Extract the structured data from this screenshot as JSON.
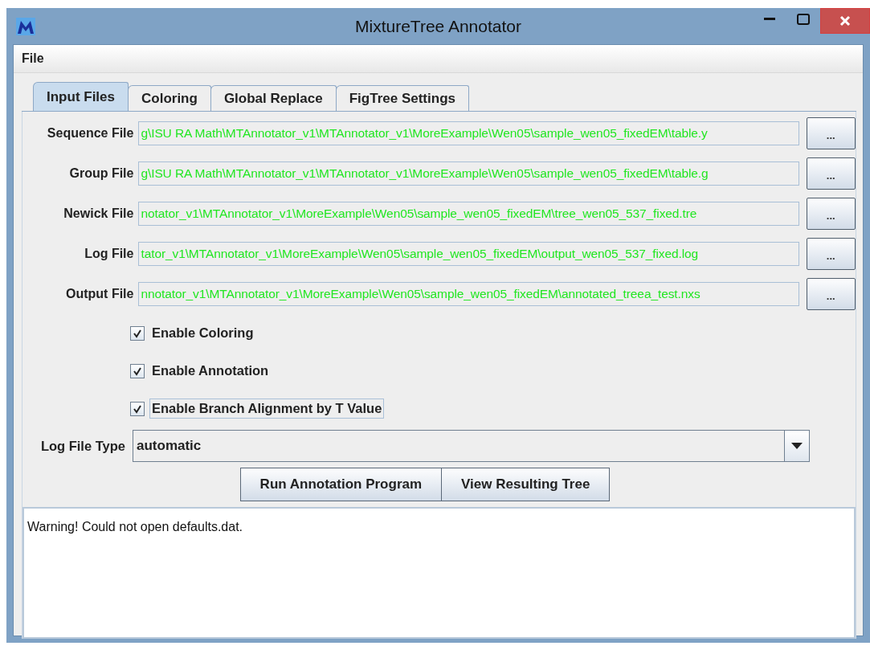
{
  "window": {
    "title": "MixtureTree Annotator"
  },
  "menu": [
    "File"
  ],
  "tabs": [
    {
      "label": "Input Files",
      "selected": true
    },
    {
      "label": "Coloring",
      "selected": false
    },
    {
      "label": "Global Replace",
      "selected": false
    },
    {
      "label": "FigTree Settings",
      "selected": false
    }
  ],
  "file_fields": [
    {
      "label": "Sequence File",
      "value": "g\\ISU RA Math\\MTAnnotator_v1\\MTAnnotator_v1\\MoreExample\\Wen05\\sample_wen05_fixedEM\\table.y",
      "button": "..."
    },
    {
      "label": "Group File",
      "value": "g\\ISU RA Math\\MTAnnotator_v1\\MTAnnotator_v1\\MoreExample\\Wen05\\sample_wen05_fixedEM\\table.g",
      "button": "..."
    },
    {
      "label": "Newick File",
      "value": "notator_v1\\MTAnnotator_v1\\MoreExample\\Wen05\\sample_wen05_fixedEM\\tree_wen05_537_fixed.tre",
      "button": "..."
    },
    {
      "label": "Log File",
      "value": "tator_v1\\MTAnnotator_v1\\MoreExample\\Wen05\\sample_wen05_fixedEM\\output_wen05_537_fixed.log",
      "button": "..."
    },
    {
      "label": "Output File",
      "value": "nnotator_v1\\MTAnnotator_v1\\MoreExample\\Wen05\\sample_wen05_fixedEM\\annotated_treea_test.nxs",
      "button": "..."
    }
  ],
  "checkboxes": [
    {
      "label": "Enable Coloring",
      "checked": true,
      "focused": false
    },
    {
      "label": "Enable Annotation",
      "checked": true,
      "focused": false
    },
    {
      "label": "Enable Branch Alignment by T Value",
      "checked": true,
      "focused": true
    }
  ],
  "log_file_type": {
    "label": "Log File Type",
    "value": "automatic"
  },
  "buttons": [
    "Run Annotation Program",
    "View Resulting Tree"
  ],
  "output_log": "Warning! Could not open defaults.dat."
}
